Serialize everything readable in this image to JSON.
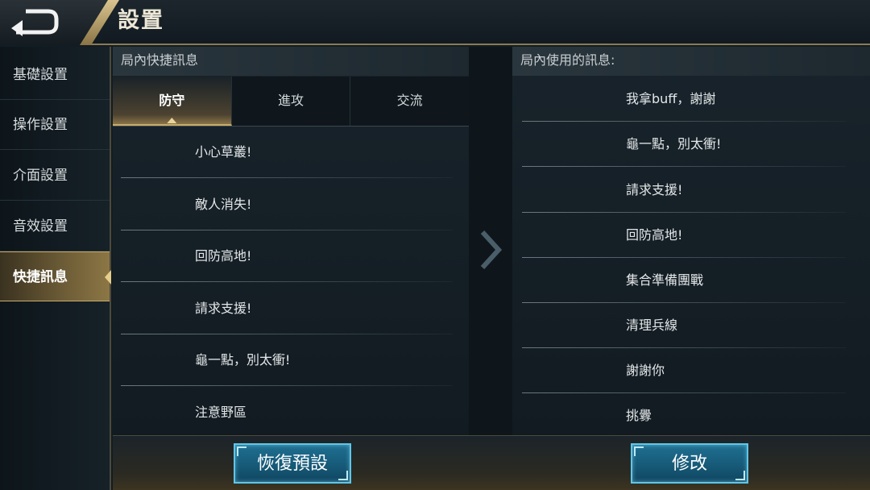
{
  "header": {
    "title": "設置",
    "back_icon": "back-arrow-icon"
  },
  "sidebar": {
    "items": [
      {
        "label": "基礎設置",
        "active": false
      },
      {
        "label": "操作設置",
        "active": false
      },
      {
        "label": "介面設置",
        "active": false
      },
      {
        "label": "音效設置",
        "active": false
      },
      {
        "label": "快捷訊息",
        "active": true
      }
    ]
  },
  "left_panel": {
    "header": "局內快捷訊息",
    "tabs": [
      {
        "label": "防守",
        "active": true
      },
      {
        "label": "進攻",
        "active": false
      },
      {
        "label": "交流",
        "active": false
      }
    ],
    "messages": [
      "小心草叢!",
      "敵人消失!",
      "回防高地!",
      "請求支援!",
      "龜一點，別太衝!",
      "注意野區"
    ]
  },
  "transfer": {
    "icon": "chevron-right-icon"
  },
  "right_panel": {
    "header": "局內使用的訊息:",
    "messages": [
      "我拿buff，謝謝",
      "龜一點，別太衝!",
      "請求支援!",
      "回防高地!",
      "集合準備團戰",
      "清理兵線",
      "謝謝你",
      "挑釁"
    ]
  },
  "actions": {
    "reset_label": "恢復預設",
    "modify_label": "修改"
  },
  "colors": {
    "accent_gold": "#c9ad6b",
    "button_blue": "#1f6f92",
    "button_border": "#5fc6e8"
  }
}
